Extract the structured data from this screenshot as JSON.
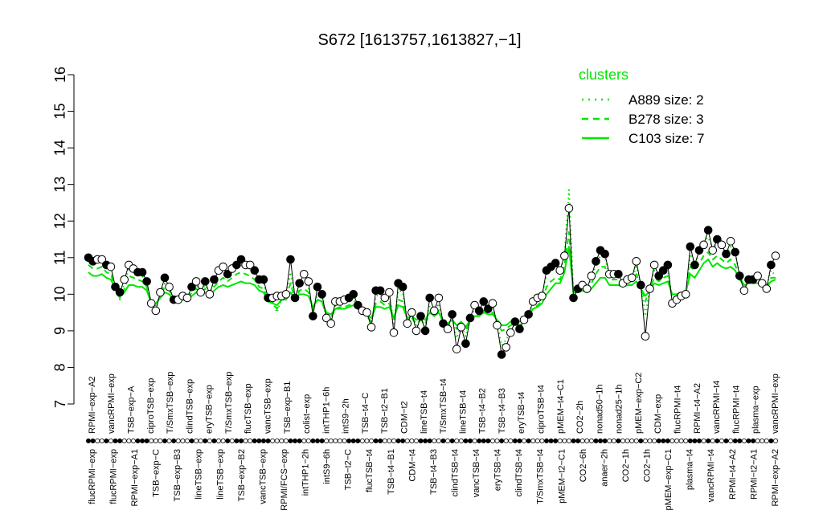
{
  "chart_data": {
    "type": "line",
    "title": "S672 [1613757,1613827,−1]",
    "ylim": [
      7,
      16
    ],
    "yticks": [
      7,
      8,
      9,
      10,
      11,
      12,
      13,
      14,
      15,
      16
    ],
    "grid": false,
    "legend": {
      "title": "clusters",
      "placement": "top-right",
      "color": "#00e600",
      "entries": [
        {
          "label": "A889 size: 2",
          "style": "dotted"
        },
        {
          "label": "B278 size: 3",
          "style": "dashed"
        },
        {
          "label": "C103 size: 7",
          "style": "solid"
        }
      ]
    },
    "x_labels_top": [
      "RPMI−exp−A2",
      "vancRPMI−exp",
      "TSB−exp−A",
      "ciproTSB−exp",
      "T/SmxTSB−exp",
      "clindTSB−exp",
      "eryTSB−exp",
      "T/SmxTSB−exp",
      "flucTSB−exp",
      "vancTSB−exp",
      "TSB−exp−B1",
      "colist−exp",
      "intTHP1−6h",
      "intS9−2h",
      "TSB−t4−C",
      "TSB−t2−B1",
      "CDM−t2",
      "lineTSB−t4",
      "T/SmxTSB−t4",
      "lineTSB−t4",
      "TSB−t4−B2",
      "TSB−t4−B3",
      "eryTSB−t4",
      "ciproTSB−t4",
      "pMEM−t4−C1",
      "CO2−2h",
      "nonad50−1h",
      "nonad25−1h",
      "pMEM−exp−C2",
      "CDM−exp",
      "flucRPMI−t4",
      "RPMI−t4−A2",
      "vancRPMI−t4",
      "flucRPMI−t4",
      "plasma−exp",
      "vancRPMI−exp"
    ],
    "x_labels_bottom": [
      "flucRPMI−exp",
      "flucRPMI−exp",
      "RPMI−exp−A1",
      "TSB−exp−C",
      "TSB−exp−B3",
      "lineTSB−exp",
      "lineTSB−exp",
      "TSB−exp−B2",
      "vancTSB−exp",
      "RPMI/FCS−exp",
      "intTHP1−2h",
      "intS9−6h",
      "TSB−t2−C",
      "flucTSB−t4",
      "TSB−t4−B1",
      "CDM−t4",
      "TSB−t4−B3",
      "clindTSB−t4",
      "vancTSB−t4",
      "eryTSB−t4",
      "clindTSB−t4",
      "T/SmxTSB−t4",
      "pMEM−t2−C1",
      "CO2−6h",
      "anaer−2h",
      "CO2−1h",
      "CO2−1h",
      "pMEM−exp−C1",
      "plasma−t4",
      "vancRPMI−t4",
      "RPMI−t4−A2",
      "RPMI−t2−A1",
      "RPMI−exp−A2"
    ],
    "samples": [
      {
        "y": 11.0,
        "filled": true
      },
      {
        "y": 10.9,
        "filled": true
      },
      {
        "y": 10.95,
        "filled": false
      },
      {
        "y": 10.95,
        "filled": false
      },
      {
        "y": 10.8,
        "filled": true
      },
      {
        "y": 10.75,
        "filled": false
      },
      {
        "y": 10.2,
        "filled": true
      },
      {
        "y": 10.05,
        "filled": true
      },
      {
        "y": 10.4,
        "filled": false
      },
      {
        "y": 10.8,
        "filled": false
      },
      {
        "y": 10.7,
        "filled": false
      },
      {
        "y": 10.6,
        "filled": true
      },
      {
        "y": 10.6,
        "filled": true
      },
      {
        "y": 10.35,
        "filled": true
      },
      {
        "y": 9.75,
        "filled": false
      },
      {
        "y": 9.55,
        "filled": false
      },
      {
        "y": 10.05,
        "filled": false
      },
      {
        "y": 10.45,
        "filled": true
      },
      {
        "y": 10.2,
        "filled": false
      },
      {
        "y": 9.85,
        "filled": true
      },
      {
        "y": 9.85,
        "filled": false
      },
      {
        "y": 9.95,
        "filled": false
      },
      {
        "y": 9.9,
        "filled": false
      },
      {
        "y": 10.2,
        "filled": true
      },
      {
        "y": 10.35,
        "filled": false
      },
      {
        "y": 10.05,
        "filled": false
      },
      {
        "y": 10.35,
        "filled": true
      },
      {
        "y": 10.0,
        "filled": false
      },
      {
        "y": 10.4,
        "filled": true
      },
      {
        "y": 10.65,
        "filled": false
      },
      {
        "y": 10.75,
        "filled": false
      },
      {
        "y": 10.55,
        "filled": true
      },
      {
        "y": 10.7,
        "filled": false
      },
      {
        "y": 10.8,
        "filled": true
      },
      {
        "y": 10.95,
        "filled": true
      },
      {
        "y": 10.8,
        "filled": false
      },
      {
        "y": 10.8,
        "filled": false
      },
      {
        "y": 10.65,
        "filled": true
      },
      {
        "y": 10.4,
        "filled": true
      },
      {
        "y": 10.4,
        "filled": true
      },
      {
        "y": 9.9,
        "filled": true
      },
      {
        "y": 9.9,
        "filled": false
      },
      {
        "y": 9.95,
        "filled": false
      },
      {
        "y": 9.95,
        "filled": false
      },
      {
        "y": 10.0,
        "filled": false
      },
      {
        "y": 10.95,
        "filled": true
      },
      {
        "y": 9.9,
        "filled": true
      },
      {
        "y": 10.3,
        "filled": true
      },
      {
        "y": 10.55,
        "filled": false
      },
      {
        "y": 10.35,
        "filled": false
      },
      {
        "y": 9.4,
        "filled": true
      },
      {
        "y": 10.2,
        "filled": true
      },
      {
        "y": 10.0,
        "filled": true
      },
      {
        "y": 9.35,
        "filled": false
      },
      {
        "y": 9.2,
        "filled": false
      },
      {
        "y": 9.8,
        "filled": false
      },
      {
        "y": 9.8,
        "filled": false
      },
      {
        "y": 9.85,
        "filled": false
      },
      {
        "y": 9.9,
        "filled": true
      },
      {
        "y": 10.0,
        "filled": true
      },
      {
        "y": 9.7,
        "filled": true
      },
      {
        "y": 9.55,
        "filled": false
      },
      {
        "y": 9.5,
        "filled": false
      },
      {
        "y": 9.1,
        "filled": false
      },
      {
        "y": 10.1,
        "filled": true
      },
      {
        "y": 10.1,
        "filled": true
      },
      {
        "y": 9.9,
        "filled": false
      },
      {
        "y": 10.05,
        "filled": false
      },
      {
        "y": 8.95,
        "filled": false
      },
      {
        "y": 10.3,
        "filled": true
      },
      {
        "y": 10.2,
        "filled": true
      },
      {
        "y": 9.2,
        "filled": false
      },
      {
        "y": 9.5,
        "filled": false
      },
      {
        "y": 9.0,
        "filled": false
      },
      {
        "y": 9.4,
        "filled": true
      },
      {
        "y": 9.0,
        "filled": true
      },
      {
        "y": 9.9,
        "filled": true
      },
      {
        "y": 9.55,
        "filled": false
      },
      {
        "y": 9.9,
        "filled": false
      },
      {
        "y": 9.2,
        "filled": true
      },
      {
        "y": 9.05,
        "filled": false
      },
      {
        "y": 9.45,
        "filled": true
      },
      {
        "y": 8.5,
        "filled": false
      },
      {
        "y": 9.1,
        "filled": false
      },
      {
        "y": 8.65,
        "filled": true
      },
      {
        "y": 9.35,
        "filled": true
      },
      {
        "y": 9.7,
        "filled": false
      },
      {
        "y": 9.55,
        "filled": true
      },
      {
        "y": 9.8,
        "filled": true
      },
      {
        "y": 9.6,
        "filled": true
      },
      {
        "y": 9.75,
        "filled": false
      },
      {
        "y": 9.15,
        "filled": false
      },
      {
        "y": 8.35,
        "filled": true
      },
      {
        "y": 8.55,
        "filled": false
      },
      {
        "y": 8.95,
        "filled": false
      },
      {
        "y": 9.25,
        "filled": true
      },
      {
        "y": 9.05,
        "filled": true
      },
      {
        "y": 9.3,
        "filled": false
      },
      {
        "y": 9.45,
        "filled": true
      },
      {
        "y": 9.8,
        "filled": false
      },
      {
        "y": 9.9,
        "filled": false
      },
      {
        "y": 9.95,
        "filled": false
      },
      {
        "y": 10.65,
        "filled": true
      },
      {
        "y": 10.75,
        "filled": true
      },
      {
        "y": 10.85,
        "filled": true
      },
      {
        "y": 10.65,
        "filled": false
      },
      {
        "y": 11.05,
        "filled": false
      },
      {
        "y": 12.35,
        "filled": false
      },
      {
        "y": 9.9,
        "filled": true
      },
      {
        "y": 10.15,
        "filled": true
      },
      {
        "y": 10.25,
        "filled": false
      },
      {
        "y": 10.15,
        "filled": false
      },
      {
        "y": 10.5,
        "filled": false
      },
      {
        "y": 10.9,
        "filled": true
      },
      {
        "y": 11.2,
        "filled": true
      },
      {
        "y": 11.1,
        "filled": true
      },
      {
        "y": 10.55,
        "filled": false
      },
      {
        "y": 10.55,
        "filled": false
      },
      {
        "y": 10.55,
        "filled": true
      },
      {
        "y": 10.3,
        "filled": false
      },
      {
        "y": 10.4,
        "filled": false
      },
      {
        "y": 10.45,
        "filled": false
      },
      {
        "y": 10.9,
        "filled": false
      },
      {
        "y": 10.25,
        "filled": true
      },
      {
        "y": 8.85,
        "filled": false
      },
      {
        "y": 10.15,
        "filled": false
      },
      {
        "y": 10.8,
        "filled": false
      },
      {
        "y": 10.5,
        "filled": true
      },
      {
        "y": 10.65,
        "filled": true
      },
      {
        "y": 10.8,
        "filled": true
      },
      {
        "y": 9.75,
        "filled": false
      },
      {
        "y": 9.85,
        "filled": false
      },
      {
        "y": 9.95,
        "filled": false
      },
      {
        "y": 10.0,
        "filled": false
      },
      {
        "y": 11.3,
        "filled": true
      },
      {
        "y": 10.8,
        "filled": true
      },
      {
        "y": 11.2,
        "filled": true
      },
      {
        "y": 11.35,
        "filled": false
      },
      {
        "y": 11.75,
        "filled": true
      },
      {
        "y": 11.2,
        "filled": false
      },
      {
        "y": 11.5,
        "filled": true
      },
      {
        "y": 11.35,
        "filled": false
      },
      {
        "y": 11.1,
        "filled": true
      },
      {
        "y": 11.45,
        "filled": false
      },
      {
        "y": 11.15,
        "filled": true
      },
      {
        "y": 10.5,
        "filled": true
      },
      {
        "y": 10.1,
        "filled": false
      },
      {
        "y": 10.4,
        "filled": true
      },
      {
        "y": 10.4,
        "filled": true
      },
      {
        "y": 10.5,
        "filled": false
      },
      {
        "y": 10.3,
        "filled": false
      },
      {
        "y": 10.15,
        "filled": false
      },
      {
        "y": 10.8,
        "filled": true
      },
      {
        "y": 11.05,
        "filled": false
      }
    ],
    "cluster_A889": [
      10.9,
      10.85,
      10.9,
      10.9,
      10.75,
      10.65,
      10.2,
      9.85,
      10.3,
      10.7,
      10.65,
      10.55,
      10.5,
      10.3,
      9.75,
      9.6,
      10.0,
      10.3,
      10.15,
      9.85,
      9.85,
      9.9,
      9.85,
      10.1,
      10.25,
      10.05,
      10.25,
      10.05,
      10.3,
      10.55,
      10.65,
      10.5,
      10.6,
      10.7,
      10.8,
      10.7,
      10.7,
      10.6,
      10.35,
      10.3,
      9.85,
      9.8,
      9.5,
      9.9,
      9.95,
      10.6,
      9.85,
      10.2,
      10.3,
      10.2,
      9.5,
      10.0,
      9.9,
      9.35,
      9.3,
      9.7,
      9.75,
      9.75,
      9.8,
      9.85,
      9.7,
      9.55,
      9.45,
      9.2,
      9.95,
      10.0,
      9.85,
      9.95,
      9.2,
      10.1,
      10.05,
      9.25,
      9.4,
      9.1,
      9.35,
      9.1,
      9.7,
      9.5,
      9.75,
      9.25,
      9.1,
      9.35,
      8.8,
      9.15,
      8.85,
      9.3,
      9.6,
      9.5,
      9.7,
      9.55,
      9.65,
      9.2,
      8.6,
      8.75,
      9.0,
      9.2,
      9.1,
      9.3,
      9.45,
      9.75,
      9.85,
      9.95,
      10.55,
      10.65,
      10.75,
      10.6,
      11.1,
      12.85,
      10.0,
      10.15,
      10.2,
      10.15,
      10.45,
      10.8,
      11.05,
      11.0,
      10.5,
      10.5,
      10.5,
      10.3,
      10.4,
      10.4,
      10.75,
      10.25,
      9.4,
      10.15,
      10.65,
      10.45,
      10.6,
      10.7,
      9.8,
      9.85,
      9.95,
      9.95,
      11.1,
      10.85,
      11.1,
      11.45,
      11.55,
      11.25,
      11.4,
      11.3,
      11.1,
      11.3,
      11.1,
      10.55,
      10.2,
      10.35,
      10.4,
      10.45,
      10.3,
      10.2,
      10.65,
      10.5
    ],
    "cluster_B278": [
      10.8,
      10.7,
      10.7,
      10.75,
      10.6,
      10.55,
      10.15,
      9.9,
      10.15,
      10.5,
      10.45,
      10.4,
      10.35,
      10.2,
      9.7,
      9.7,
      9.95,
      10.2,
      10.1,
      9.85,
      9.85,
      9.85,
      9.85,
      10.05,
      10.15,
      10.05,
      10.15,
      10.0,
      10.2,
      10.35,
      10.45,
      10.35,
      10.45,
      10.55,
      10.6,
      10.55,
      10.5,
      10.4,
      10.2,
      10.15,
      9.8,
      9.75,
      9.6,
      9.85,
      9.9,
      10.3,
      9.85,
      10.1,
      10.15,
      10.05,
      9.6,
      9.85,
      9.8,
      9.4,
      9.35,
      9.6,
      9.65,
      9.65,
      9.7,
      9.75,
      9.6,
      9.5,
      9.4,
      9.25,
      9.75,
      9.8,
      9.7,
      9.75,
      9.3,
      9.85,
      9.8,
      9.3,
      9.35,
      9.2,
      9.3,
      9.2,
      9.5,
      9.4,
      9.55,
      9.2,
      9.15,
      9.3,
      9.05,
      9.2,
      9.0,
      9.3,
      9.45,
      9.4,
      9.55,
      9.45,
      9.5,
      9.25,
      9.0,
      9.05,
      9.15,
      9.2,
      9.15,
      9.25,
      9.4,
      9.6,
      9.7,
      9.8,
      10.2,
      10.35,
      10.45,
      10.4,
      10.8,
      11.7,
      10.05,
      10.1,
      10.15,
      10.1,
      10.3,
      10.55,
      10.75,
      10.75,
      10.4,
      10.4,
      10.4,
      10.3,
      10.35,
      10.35,
      10.55,
      10.2,
      9.8,
      10.15,
      10.45,
      10.35,
      10.45,
      10.5,
      9.9,
      9.95,
      10.0,
      10.0,
      10.75,
      10.65,
      10.85,
      11.05,
      11.15,
      10.95,
      11.05,
      10.95,
      10.85,
      10.95,
      10.8,
      10.45,
      10.25,
      10.3,
      10.35,
      10.35,
      10.25,
      10.2,
      10.45,
      10.45
    ],
    "cluster_C103": [
      10.6,
      10.5,
      10.5,
      10.55,
      10.45,
      10.4,
      10.15,
      9.95,
      10.05,
      10.25,
      10.25,
      10.2,
      10.2,
      10.1,
      9.75,
      9.75,
      9.9,
      10.05,
      10.0,
      9.85,
      9.85,
      9.85,
      9.85,
      9.95,
      10.05,
      10.0,
      10.05,
      9.95,
      10.1,
      10.2,
      10.25,
      10.2,
      10.25,
      10.3,
      10.35,
      10.3,
      10.3,
      10.25,
      10.1,
      10.05,
      9.8,
      9.75,
      9.7,
      9.85,
      9.85,
      10.05,
      9.85,
      10.0,
      10.0,
      9.95,
      9.65,
      9.85,
      9.8,
      9.5,
      9.45,
      9.6,
      9.6,
      9.6,
      9.65,
      9.7,
      9.6,
      9.5,
      9.45,
      9.35,
      9.65,
      9.65,
      9.6,
      9.65,
      9.35,
      9.7,
      9.65,
      9.35,
      9.4,
      9.3,
      9.35,
      9.3,
      9.5,
      9.4,
      9.5,
      9.25,
      9.2,
      9.3,
      9.15,
      9.25,
      9.1,
      9.3,
      9.4,
      9.4,
      9.5,
      9.45,
      9.45,
      9.3,
      9.15,
      9.15,
      9.25,
      9.3,
      9.25,
      9.35,
      9.45,
      9.6,
      9.65,
      9.75,
      10.0,
      10.15,
      10.3,
      10.3,
      10.6,
      11.3,
      10.05,
      10.05,
      10.1,
      10.05,
      10.15,
      10.3,
      10.45,
      10.45,
      10.25,
      10.25,
      10.25,
      10.2,
      10.25,
      10.25,
      10.35,
      10.15,
      9.95,
      10.1,
      10.3,
      10.25,
      10.3,
      10.35,
      10.0,
      10.0,
      10.05,
      10.05,
      10.55,
      10.45,
      10.65,
      10.85,
      10.95,
      10.75,
      10.85,
      10.75,
      10.7,
      10.75,
      10.65,
      10.4,
      10.25,
      10.3,
      10.3,
      10.3,
      10.25,
      10.2,
      10.35,
      10.4
    ]
  }
}
